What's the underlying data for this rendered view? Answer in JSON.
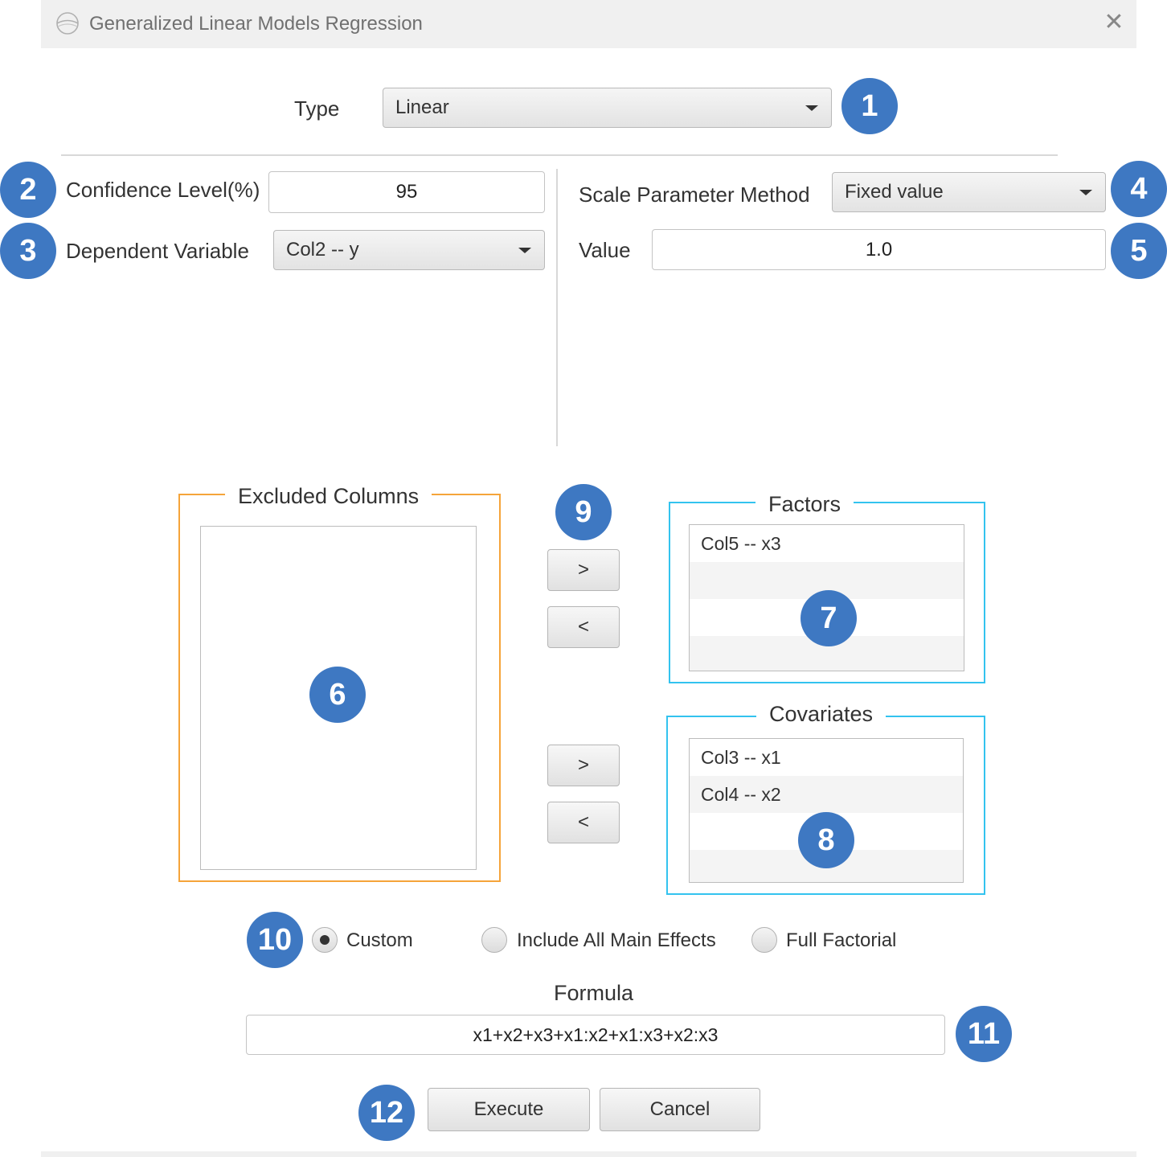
{
  "window": {
    "title": "Generalized Linear Models Regression",
    "close_glyph": "✕"
  },
  "type_field": {
    "label": "Type",
    "value": "Linear"
  },
  "confidence": {
    "label": "Confidence Level(%)",
    "value": "95"
  },
  "dependent": {
    "label": "Dependent Variable",
    "value": "Col2 -- y"
  },
  "scale_method": {
    "label": "Scale Parameter Method",
    "value": "Fixed value"
  },
  "scale_value": {
    "label": "Value",
    "value": "1.0"
  },
  "excluded": {
    "title": "Excluded Columns",
    "items": []
  },
  "factors": {
    "title": "Factors",
    "items": [
      "Col5 -- x3"
    ]
  },
  "covariates": {
    "title": "Covariates",
    "items": [
      "Col3 -- x1",
      "Col4 -- x2"
    ]
  },
  "move_buttons": {
    "right": ">",
    "left": "<"
  },
  "model_options": {
    "options": [
      "Custom",
      "Include All Main Effects",
      "Full Factorial"
    ],
    "selected": "Custom"
  },
  "formula": {
    "label": "Formula",
    "value": "x1+x2+x3+x1:x2+x1:x3+x2:x3"
  },
  "actions": {
    "execute": "Execute",
    "cancel": "Cancel"
  },
  "callouts": [
    "1",
    "2",
    "3",
    "4",
    "5",
    "6",
    "7",
    "8",
    "9",
    "10",
    "11",
    "12"
  ],
  "colors": {
    "callout": "#3e78c2",
    "excluded_border": "#f5a43a",
    "factor_border": "#33c3ef"
  }
}
